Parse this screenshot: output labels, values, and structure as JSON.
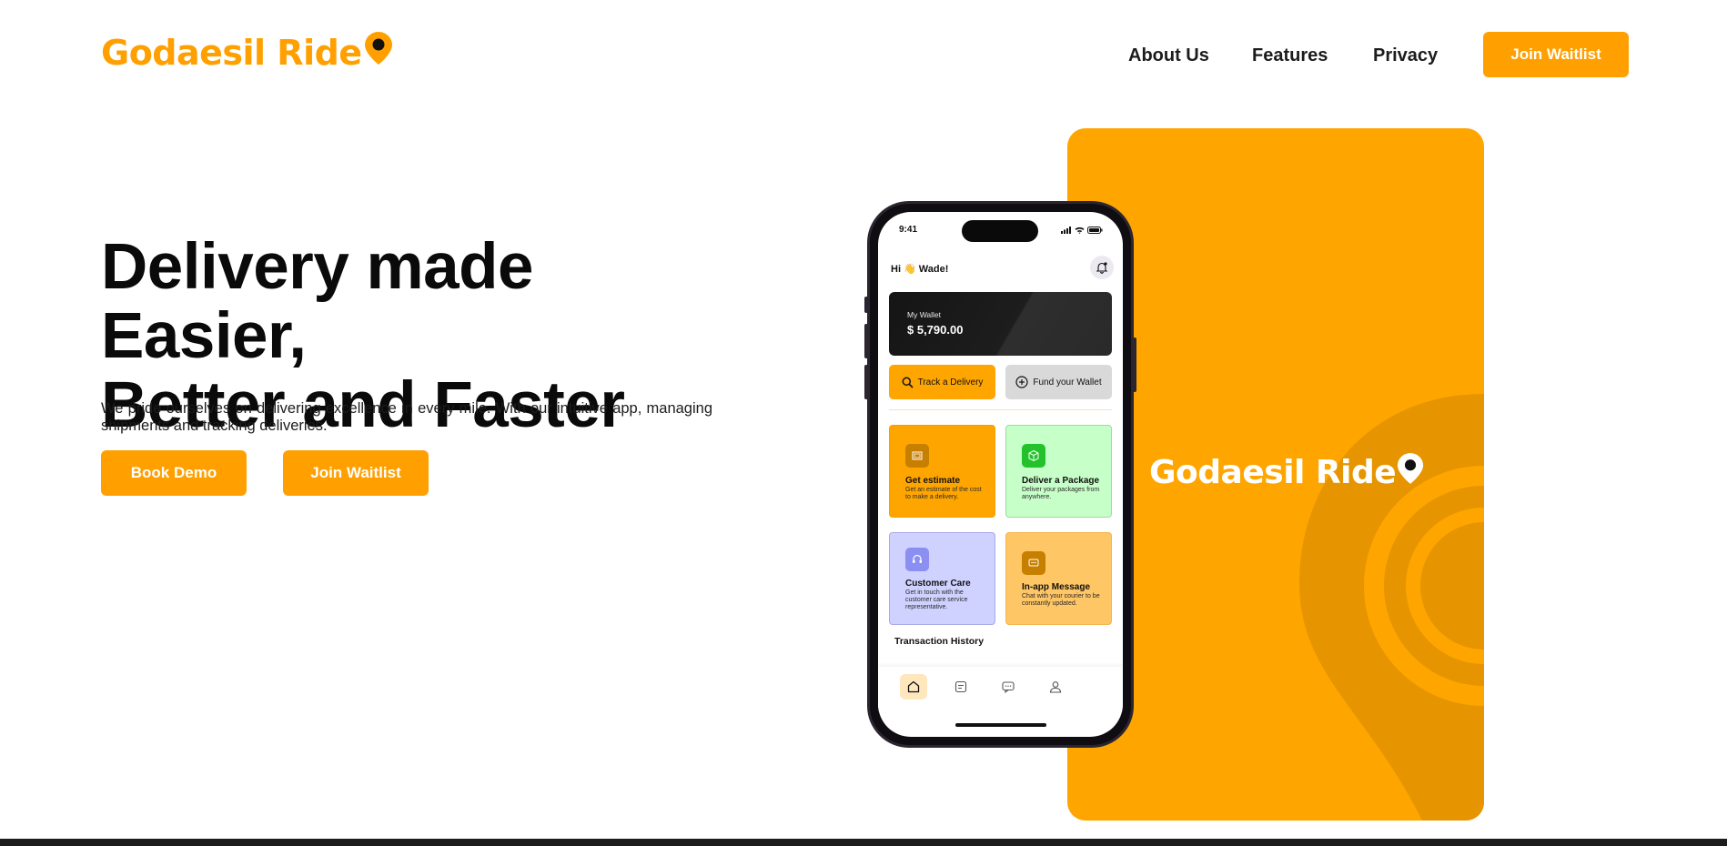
{
  "brand": {
    "name": "Godaesil Ride",
    "accent": "#FFA000",
    "card_color": "#FFA500"
  },
  "nav": {
    "links": [
      "About Us",
      "Features",
      "Privacy"
    ],
    "cta_label": "Join Waitlist"
  },
  "hero": {
    "title_line1": "Delivery made Easier,",
    "title_line2": "Better and Faster",
    "description": "We pride ourselves on delivering excellence in every mile. With our intuitive app, managing shipments and tracking deliveries.",
    "primary_button": "Book Demo",
    "secondary_button": "Join Waitlist"
  },
  "phone": {
    "time": "9:41",
    "greeting": "Hi 👋 Wade!",
    "wallet_label": "My Wallet",
    "wallet_amount": "$ 5,790.00",
    "track_button": "Track a Delivery",
    "fund_button": "Fund your Wallet",
    "tiles": [
      {
        "title": "Get estimate",
        "desc": "Get an estimate of the cost to make a delivery.",
        "icon": "receipt-icon"
      },
      {
        "title": "Deliver a Package",
        "desc": "Deliver your packages from anywhere.",
        "icon": "box-icon"
      },
      {
        "title": "Customer Care",
        "desc": "Get in touch with the customer care service representative.",
        "icon": "headset-icon"
      },
      {
        "title": "In-app Message",
        "desc": "Chat with your courier to be constantly updated.",
        "icon": "chat-icon"
      }
    ],
    "section_title": "Transaction History",
    "tabs": [
      "home-icon",
      "orders-icon",
      "messages-icon",
      "profile-icon"
    ],
    "active_tab": 0
  }
}
